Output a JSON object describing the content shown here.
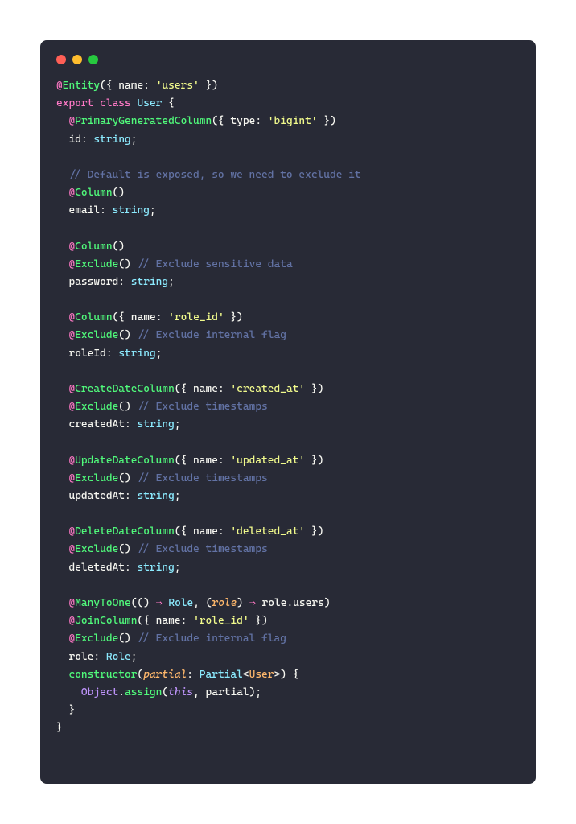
{
  "code": {
    "entity_name": "'users'",
    "class_name": "User",
    "pgc_type": "'bigint'",
    "id_prop": "id",
    "str_type": "string",
    "comment_default": "// Default is exposed, so we need to exclude it",
    "email_prop": "email",
    "comment_sensitive": "// Exclude sensitive data",
    "password_prop": "password",
    "role_id_name": "'role_id'",
    "comment_flag": "// Exclude internal flag",
    "roleid_prop": "roleId",
    "created_at_name": "'created_at'",
    "comment_ts": "// Exclude timestamps",
    "createdat_prop": "createdAt",
    "updated_at_name": "'updated_at'",
    "updatedat_prop": "updatedAt",
    "deleted_at_name": "'deleted_at'",
    "deletedat_prop": "deletedAt",
    "role_type": "Role",
    "role_users": "role.users",
    "role_prop": "role",
    "ctor": "constructor",
    "partial_param": "partial",
    "partial_type": "Partial",
    "user_generic": "User",
    "object_name": "Object",
    "assign_fn": "assign",
    "this_kw": "this",
    "decorators": {
      "Entity": "Entity",
      "PrimaryGeneratedColumn": "PrimaryGeneratedColumn",
      "Column": "Column",
      "Exclude": "Exclude",
      "CreateDateColumn": "CreateDateColumn",
      "UpdateDateColumn": "UpdateDateColumn",
      "DeleteDateColumn": "DeleteDateColumn",
      "ManyToOne": "ManyToOne",
      "JoinColumn": "JoinColumn"
    },
    "kw": {
      "export": "export",
      "class": "class",
      "name": "name",
      "type": "type"
    }
  }
}
